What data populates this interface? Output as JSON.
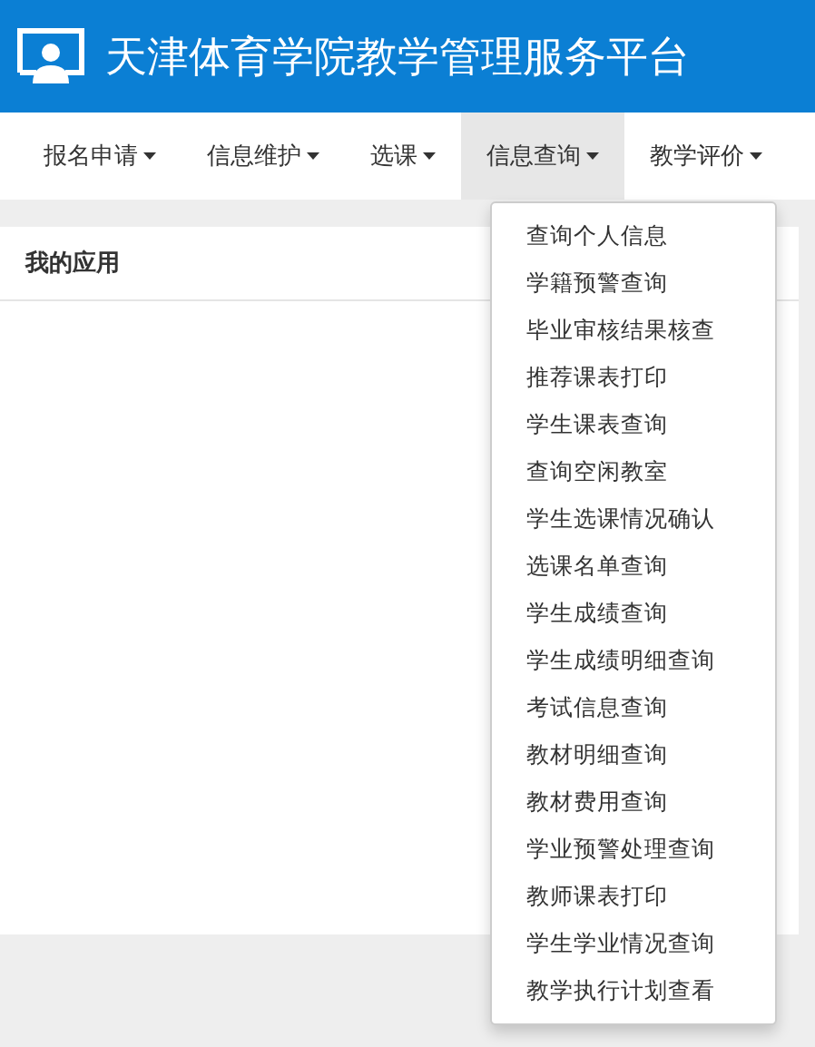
{
  "header": {
    "title": "天津体育学院教学管理服务平台"
  },
  "nav": [
    {
      "label": "报名申请",
      "selected": false
    },
    {
      "label": "信息维护",
      "selected": false
    },
    {
      "label": "选课",
      "selected": false
    },
    {
      "label": "信息查询",
      "selected": true
    },
    {
      "label": "教学评价",
      "selected": false
    }
  ],
  "dropdown": {
    "items": [
      "查询个人信息",
      "学籍预警查询",
      "毕业审核结果核查",
      "推荐课表打印",
      "学生课表查询",
      "查询空闲教室",
      "学生选课情况确认",
      "选课名单查询",
      "学生成绩查询",
      "学生成绩明细查询",
      "考试信息查询",
      "教材明细查询",
      "教材费用查询",
      "学业预警处理查询",
      "教师课表打印",
      "学生学业情况查询",
      "教学执行计划查看"
    ]
  },
  "panel": {
    "title": "我的应用"
  }
}
